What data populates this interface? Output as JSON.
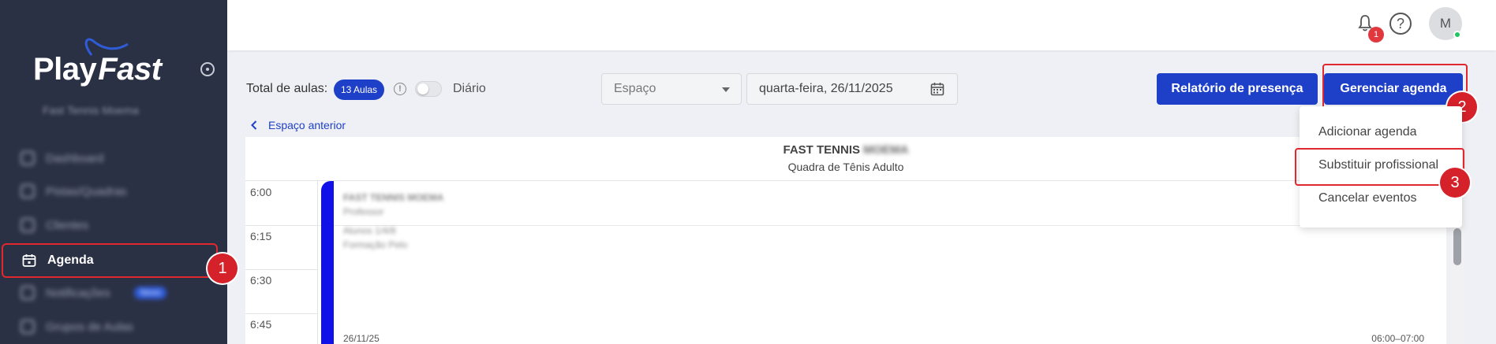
{
  "app": {
    "logo_play": "Play",
    "logo_fast": "Fast",
    "org_name": "Fast Tennis Moema"
  },
  "sidebar": {
    "items": [
      {
        "label": "Dashboard"
      },
      {
        "label": "Pistas/Quadras"
      },
      {
        "label": "Clientes"
      },
      {
        "label": "Agenda"
      },
      {
        "label": "Notificações",
        "badge": "Novo"
      },
      {
        "label": "Grupos de Aulas"
      }
    ]
  },
  "topbar": {
    "notification_count": "1",
    "help_symbol": "?",
    "avatar_initial": "M",
    "status_color": "#22c55e"
  },
  "toolbar": {
    "total_label": "Total de aulas:",
    "total_badge": "13 Aulas",
    "info_symbol": "!",
    "toggle_label": "Diário",
    "space_placeholder": "Espaço",
    "date_value": "quarta-feira, 26/11/2025",
    "relatorio_label": "Relatório de presença",
    "gerenciar_label": "Gerenciar agenda",
    "prev_space_label": "Espaço anterior"
  },
  "calendar": {
    "title": "FAST TENNIS",
    "title_hidden": "MOEMA",
    "subtitle": "Quadra de Tênis Adulto",
    "times": [
      "6:00",
      "6:15",
      "6:30",
      "6:45"
    ],
    "event": {
      "line1": "FAST TENNIS MOEMA",
      "line2": "Professor",
      "line3": "Alunos 1/4/8",
      "line4": "Formação Pelo",
      "date": "26/11/25",
      "range": "06:00–07:00",
      "color": "#1010e8"
    }
  },
  "dropdown": {
    "items": [
      "Adicionar agenda",
      "Substituir profissional",
      "Cancelar eventos"
    ]
  },
  "markers": [
    "1",
    "2",
    "3"
  ],
  "colors": {
    "primary": "#1e40c8",
    "highlight": "#e0282e",
    "sidebar_bg": "#2b3145"
  }
}
